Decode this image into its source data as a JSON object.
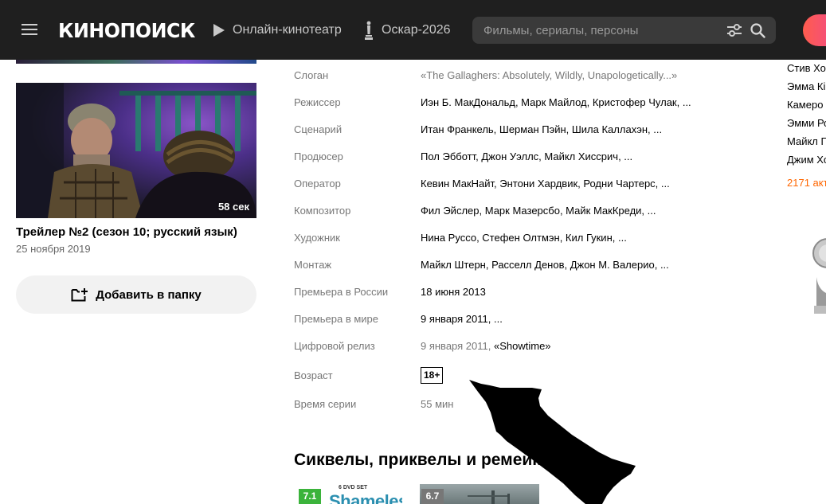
{
  "header": {
    "logo_text": "КИНОПОИСК",
    "nav": [
      {
        "label": "Онлайн-кинотеатр",
        "icon": "play-icon"
      },
      {
        "label": "Оскар-2026",
        "icon": "oscar-statuette-icon"
      }
    ],
    "search_placeholder": "Фильмы, сериалы, персоны"
  },
  "trailer": {
    "duration": "58 сек",
    "title": "Трейлер №2 (сезон 10; русский язык)",
    "date": "25 ноября 2019"
  },
  "add_folder_label": "Добавить в папку",
  "info": [
    {
      "label": "Слоган",
      "value": "«The Gallaghers: Absolutely, Wildly, Unapologetically...»"
    },
    {
      "label": "Режиссер",
      "value": "Иэн Б. МакДональд, Марк Майлод, Кристофер Чулак, ..."
    },
    {
      "label": "Сценарий",
      "value": "Итан Франкель, Шерман Пэйн, Шила Каллахэн, ..."
    },
    {
      "label": "Продюсер",
      "value": "Пол Эбботт, Джон Уэллс, Майкл Хиссрич, ..."
    },
    {
      "label": "Оператор",
      "value": "Кевин МакНайт, Энтони Хардвик, Родни Чартерс, ..."
    },
    {
      "label": "Композитор",
      "value": "Фил Эйслер, Марк Мазерсбо, Майк МакКреди, ..."
    },
    {
      "label": "Художник",
      "value": "Нина Руссо, Стефен Олтмэн, Кил Гукин, ..."
    },
    {
      "label": "Монтаж",
      "value": "Майкл Штерн, Расселл Денов, Джон М. Валерио, ..."
    },
    {
      "label": "Премьера в России",
      "value": "18 июня 2013"
    },
    {
      "label": "Премьера в мире",
      "value": "9 января 2011, ..."
    },
    {
      "label": "Цифровой релиз",
      "value_date": "9 января 2011,",
      "value_link": "«Showtime»"
    },
    {
      "label": "Возраст",
      "value": "18+"
    },
    {
      "label": "Время серии",
      "value": "55 мин"
    }
  ],
  "section_title": "Сиквелы, приквелы и ремейки",
  "related": [
    {
      "rating": "7.1",
      "cover_small": "6 DVD SET",
      "cover_big": "Shameless"
    },
    {
      "rating": "6.7"
    }
  ],
  "actors": [
    "Стив Хо",
    "Эмма Кі",
    "Камеро",
    "Эмми Ро",
    "Майкл Г",
    "Джим Хо"
  ],
  "actors_count": "2171 акт",
  "colors": {
    "header_bg": "#1f1f1f",
    "accent_orange": "#ff6600",
    "rating_green": "#3bb33b",
    "rating_grey": "#777777"
  }
}
